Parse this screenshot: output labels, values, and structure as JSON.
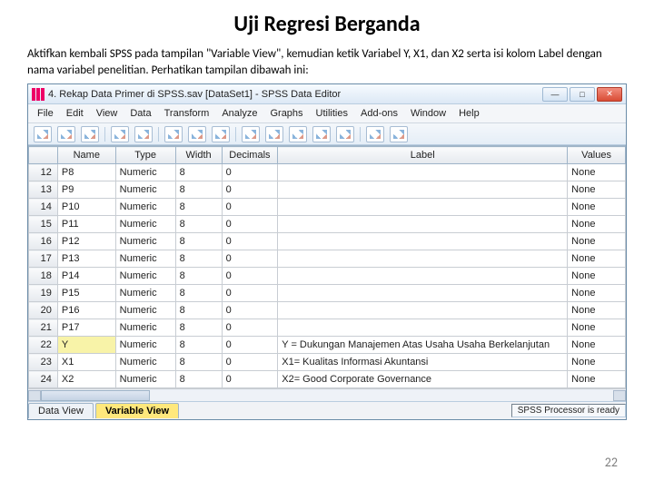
{
  "slide": {
    "title": "Uji Regresi Berganda",
    "description": "Aktifkan kembali SPSS pada tampilan \"Variable View\", kemudian ketik Variabel Y, X1, dan X2 serta isi kolom Label dengan nama variabel penelitian. Perhatikan tampilan dibawah ini:",
    "page_number": "22"
  },
  "window": {
    "title": "4. Rekap Data Primer di SPSS.sav [DataSet1] - SPSS Data Editor"
  },
  "menu": [
    "File",
    "Edit",
    "View",
    "Data",
    "Transform",
    "Analyze",
    "Graphs",
    "Utilities",
    "Add-ons",
    "Window",
    "Help"
  ],
  "columns": [
    "",
    "Name",
    "Type",
    "Width",
    "Decimals",
    "Label",
    "Values"
  ],
  "status": "SPSS Processor is ready",
  "tabs": {
    "data": "Data View",
    "var": "Variable View"
  },
  "rows": [
    {
      "n": "12",
      "name": "P8",
      "type": "Numeric",
      "width": "8",
      "dec": "0",
      "label": "",
      "values": "None"
    },
    {
      "n": "13",
      "name": "P9",
      "type": "Numeric",
      "width": "8",
      "dec": "0",
      "label": "",
      "values": "None"
    },
    {
      "n": "14",
      "name": "P10",
      "type": "Numeric",
      "width": "8",
      "dec": "0",
      "label": "",
      "values": "None"
    },
    {
      "n": "15",
      "name": "P11",
      "type": "Numeric",
      "width": "8",
      "dec": "0",
      "label": "",
      "values": "None"
    },
    {
      "n": "16",
      "name": "P12",
      "type": "Numeric",
      "width": "8",
      "dec": "0",
      "label": "",
      "values": "None"
    },
    {
      "n": "17",
      "name": "P13",
      "type": "Numeric",
      "width": "8",
      "dec": "0",
      "label": "",
      "values": "None"
    },
    {
      "n": "18",
      "name": "P14",
      "type": "Numeric",
      "width": "8",
      "dec": "0",
      "label": "",
      "values": "None"
    },
    {
      "n": "19",
      "name": "P15",
      "type": "Numeric",
      "width": "8",
      "dec": "0",
      "label": "",
      "values": "None"
    },
    {
      "n": "20",
      "name": "P16",
      "type": "Numeric",
      "width": "8",
      "dec": "0",
      "label": "",
      "values": "None"
    },
    {
      "n": "21",
      "name": "P17",
      "type": "Numeric",
      "width": "8",
      "dec": "0",
      "label": "",
      "values": "None"
    },
    {
      "n": "22",
      "name": "Y",
      "type": "Numeric",
      "width": "8",
      "dec": "0",
      "label": "Y = Dukungan Manajemen Atas Usaha Usaha Berkelanjutan",
      "values": "None",
      "sel": true
    },
    {
      "n": "23",
      "name": "X1",
      "type": "Numeric",
      "width": "8",
      "dec": "0",
      "label": "X1= Kualitas Informasi Akuntansi",
      "values": "None"
    },
    {
      "n": "24",
      "name": "X2",
      "type": "Numeric",
      "width": "8",
      "dec": "0",
      "label": "X2= Good Corporate Governance",
      "values": "None"
    }
  ]
}
